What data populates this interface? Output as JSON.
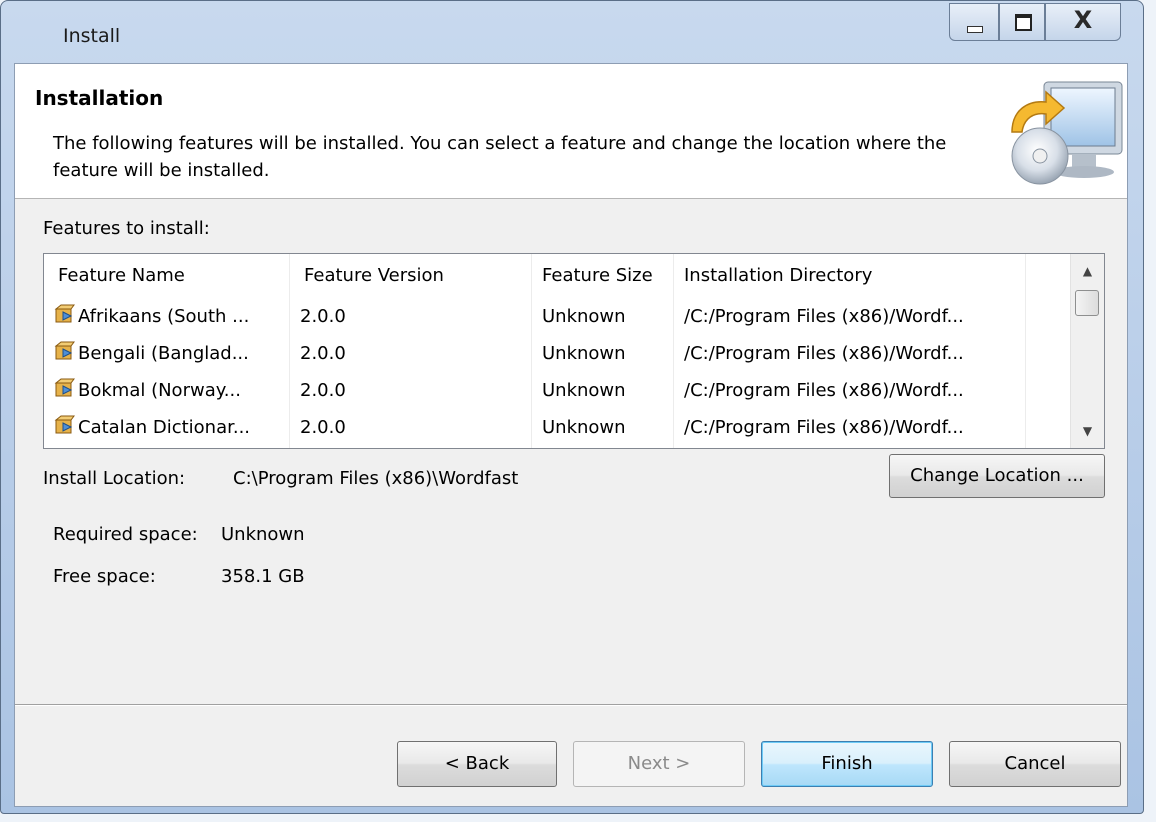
{
  "window": {
    "title": "Install"
  },
  "banner": {
    "title": "Installation",
    "description": "The following features will be installed. You can select a feature and change the location where the feature will be installed.",
    "icon": "install-computer-icon"
  },
  "features": {
    "label": "Features to install:",
    "columns": [
      "Feature Name",
      "Feature Version",
      "Feature Size",
      "Installation Directory"
    ],
    "rows": [
      {
        "name": "Afrikaans (South ...",
        "version": "2.0.0",
        "size": "Unknown",
        "directory": "/C:/Program Files (x86)/Wordf..."
      },
      {
        "name": "Bengali (Banglad...",
        "version": "2.0.0",
        "size": "Unknown",
        "directory": "/C:/Program Files (x86)/Wordf..."
      },
      {
        "name": "Bokmal (Norway...",
        "version": "2.0.0",
        "size": "Unknown",
        "directory": "/C:/Program Files (x86)/Wordf..."
      },
      {
        "name": "Catalan Dictionar...",
        "version": "2.0.0",
        "size": "Unknown",
        "directory": "/C:/Program Files (x86)/Wordf..."
      }
    ]
  },
  "location": {
    "label": "Install Location:",
    "value": "C:\\Program Files (x86)\\Wordfast",
    "change_button": "Change Location ..."
  },
  "space": {
    "required_label": "Required space:",
    "required_value": "Unknown",
    "free_label": "Free space:",
    "free_value": "358.1 GB"
  },
  "buttons": {
    "back": "< Back",
    "next": "Next >",
    "finish": "Finish",
    "cancel": "Cancel"
  },
  "window_controls": {
    "close": "X"
  }
}
